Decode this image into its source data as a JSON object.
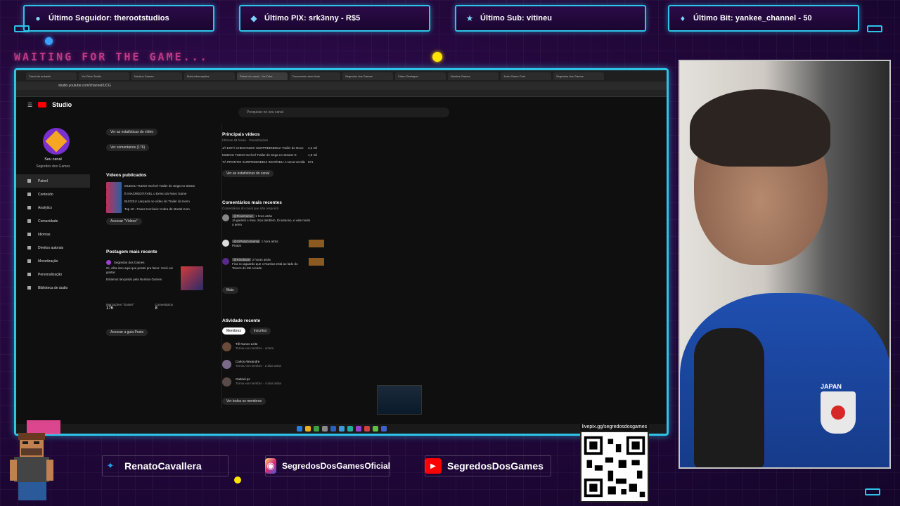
{
  "alerts": [
    {
      "icon": "user-icon",
      "label": "Último Seguidor: therootstudios"
    },
    {
      "icon": "pix-icon",
      "label": "Último PIX: srk3nny - R$5"
    },
    {
      "icon": "star-icon",
      "label": "Último Sub: vitineu"
    },
    {
      "icon": "diamond-icon",
      "label": "Último Bit: yankee_channel - 50"
    }
  ],
  "waiting_text": "WAITING FOR THE GAME...",
  "browser": {
    "tabs": [
      "Canal de entrada",
      "YouTube Studio",
      "Nuntius Games",
      "Mais informações",
      "Painel do canal - YouTube",
      "Documento sem título",
      "Segredos dos Games",
      "Vídeo Destaque",
      "Nuntius Games",
      "Justo Game Club",
      "Segredos dos Games"
    ],
    "url": "studio.youtube.com/channel/UCG"
  },
  "studio": {
    "brand": "Studio",
    "search_placeholder": "Pesquisar no seu canal",
    "channel_name": "Seu canal",
    "channel_sub": "Segredos dos Games",
    "nav": [
      "Painel",
      "Conteúdo",
      "Analytics",
      "Comunidade",
      "Idiomas",
      "Direitos autorais",
      "Monetização",
      "Personalização",
      "Biblioteca de áudio"
    ],
    "left_col": {
      "btn_stats": "Ver as estatísticas do vídeo",
      "btn_comments": "Ver comentários (176)",
      "published_title": "Vídeos publicados",
      "videos": [
        "MUDOU TUDO! Incrível Trailer do Sega no Steam",
        "É INACREDITÁVEL o Demo do Novo Game",
        "BUGOU! Lançado no vídeo do Trailer do Kenn",
        "Top 10 - Fases Incríveis: Kobra de Mortal Kom"
      ],
      "btn_videos": "Acessar \"Vídeos\"",
      "post_title": "Postagem mais recente",
      "post_author": "Segredos dos Games",
      "post_text": "Oi, olha isso aqui que postei pra fazer. Você vai gostar.",
      "post_text2": "Estamos lançando pela Nuntius Games",
      "likes_label": "Marcações \"Gostei\"",
      "likes_value": "176",
      "comments_label": "Comentários",
      "comments_value": "8",
      "btn_post": "Acessar a guia Posts"
    },
    "right_col": {
      "top_title": "Principais vídeos",
      "top_sub": "Últimas 48 horas · Visualizações",
      "top_videos": [
        {
          "title": "JÁ ESTÁ CHEGANDO! SURPREENDEU! Trailer do Novo",
          "views": "4,2 mil"
        },
        {
          "title": "MUDOU TUDO! Incrível Trailer do Sega no Steam! E",
          "views": "1,9 mil"
        },
        {
          "title": "TÁ PRONTO! SURPREENDEU! INCRÍVEL! A Nova Versão",
          "views": "871"
        }
      ],
      "btn_analytics": "Ver as estatísticas do canal",
      "comments_title": "Comentários mais recentes",
      "comments_sub": "Comentários do canal que não respondi",
      "comments": [
        {
          "user": "@FlowGamer",
          "time": "1 hora atrás",
          "text": "Já garanti o meu. Sou também, tô ansioso, e vale muito a pena"
        },
        {
          "user": "@GiPaluComenta",
          "time": "1 hora atrás",
          "text": "Pirata!"
        },
        {
          "user": "@Kinobase",
          "time": "2 horas atrás",
          "text": "Fica no aguardo que o Nuntius está ao lado do Tavern do Mk Arcade"
        }
      ],
      "btn_more": "Mais",
      "activity_title": "Atividade recente",
      "activity_tabs": [
        "Membros",
        "Inscritos"
      ],
      "members": [
        {
          "name": "Tiê Nunes Leite",
          "sub": "Tornou-se membro · ontem"
        },
        {
          "name": "Carlos Alexandre",
          "sub": "Tornou-se membro · 2 dias atrás"
        },
        {
          "name": "Gabriel.ps",
          "sub": "Tornou-se membro · 4 dias atrás"
        }
      ],
      "btn_members": "Ver todos os membros"
    }
  },
  "socials": [
    {
      "icon": "twitter-icon",
      "label": "RenatoCavallera",
      "color": "#1da1f2"
    },
    {
      "icon": "instagram-icon",
      "label": "SegredosDosGamesOficial",
      "color": "#c13584"
    },
    {
      "icon": "youtube-icon",
      "label": "SegredosDosGames",
      "color": "#ff0000"
    }
  ],
  "qr_url": "livepix.gg/segredosdosgames",
  "colors": {
    "frame": "#2ec4e8",
    "accent_pink": "#ff4fa3",
    "bg": "#24083d"
  }
}
